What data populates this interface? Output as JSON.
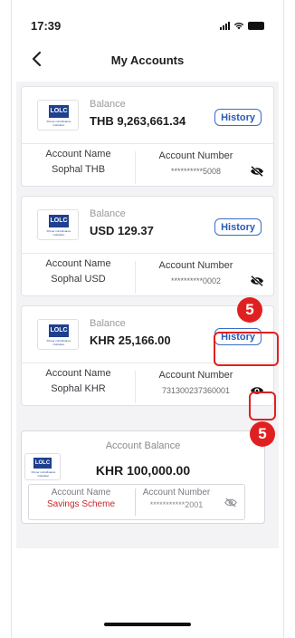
{
  "status_bar": {
    "time": "17:39"
  },
  "nav": {
    "title": "My Accounts"
  },
  "accounts": [
    {
      "balance_label": "Balance",
      "balance": "THB 9,263,661.34",
      "history_label": "History",
      "name_label": "Account Name",
      "name": "Sophal THB",
      "number_label": "Account Number",
      "number": "**********5008",
      "eye": "eye-slash-icon"
    },
    {
      "balance_label": "Balance",
      "balance": "USD 129.37",
      "history_label": "History",
      "name_label": "Account Name",
      "name": "Sophal USD",
      "number_label": "Account Number",
      "number": "**********0002",
      "eye": "eye-slash-icon"
    },
    {
      "balance_label": "Balance",
      "balance": "KHR 25,166.00",
      "history_label": "History",
      "name_label": "Account Name",
      "name": "Sophal KHR",
      "number_label": "Account Number",
      "number": "731300237360001",
      "eye": "eye-icon"
    }
  ],
  "savings": {
    "label": "Account Balance",
    "balance": "KHR 100,000.00",
    "name_label": "Account Name",
    "name": "Savings Scheme",
    "number_label": "Account Number",
    "number": "***********2001",
    "eye": "eye-slash-icon"
  },
  "logo": {
    "text": "LOLC",
    "subtext": "Khmer microfinance institution"
  },
  "callouts": [
    "5",
    "5"
  ],
  "colors": {
    "accent": "#2a5bb8",
    "callout": "#e02020",
    "savings_name": "#c62828",
    "logo": "#1f3f8f"
  }
}
